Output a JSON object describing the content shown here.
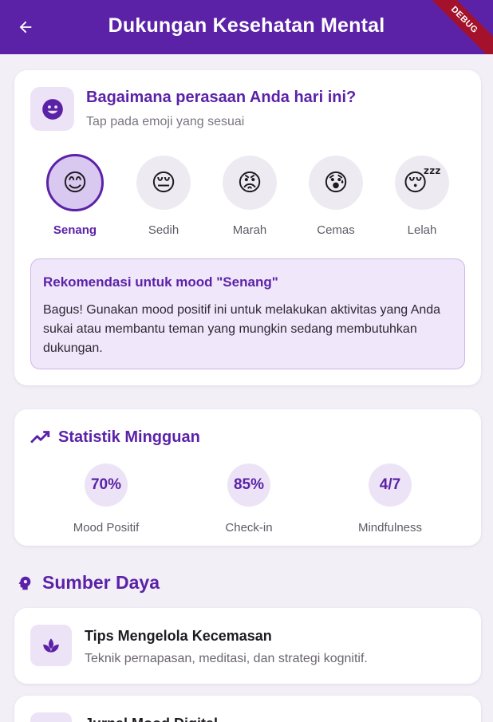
{
  "appbar": {
    "title": "Dukungan Kesehatan Mental",
    "debug_label": "DEBUG",
    "back_icon": "arrow-back-icon",
    "color": "#5b22a8"
  },
  "mood": {
    "title": "Bagaimana perasaan Anda hari ini?",
    "subtitle": "Tap pada emoji yang sesuai",
    "icon": "smiley-face-icon",
    "options": [
      {
        "emoji": "😊",
        "label": "Senang",
        "selected": true
      },
      {
        "emoji": "😔",
        "label": "Sedih",
        "selected": false
      },
      {
        "emoji": "😡",
        "label": "Marah",
        "selected": false
      },
      {
        "emoji": "😰",
        "label": "Cemas",
        "selected": false
      },
      {
        "emoji": "😴",
        "label": "Lelah",
        "selected": false
      }
    ],
    "recommendation": {
      "title": "Rekomendasi untuk mood \"Senang\"",
      "text": "Bagus! Gunakan mood positif ini untuk melakukan aktivitas yang Anda sukai atau membantu teman yang mungkin sedang membutuhkan dukungan."
    }
  },
  "stats": {
    "title": "Statistik Mingguan",
    "icon": "trending-up-icon",
    "items": [
      {
        "value": "70%",
        "label": "Mood Positif"
      },
      {
        "value": "85%",
        "label": "Check-in"
      },
      {
        "value": "4/7",
        "label": "Mindfulness"
      }
    ]
  },
  "resources": {
    "title": "Sumber Daya",
    "icon": "psychology-head-icon",
    "items": [
      {
        "title": "Tips Mengelola Kecemasan",
        "description": "Teknik pernapasan, meditasi, dan strategi kognitif.",
        "icon": "spa-lotus-icon"
      },
      {
        "title": "Jurnal Mood Digital",
        "description": "",
        "icon": "journal-icon"
      }
    ]
  }
}
